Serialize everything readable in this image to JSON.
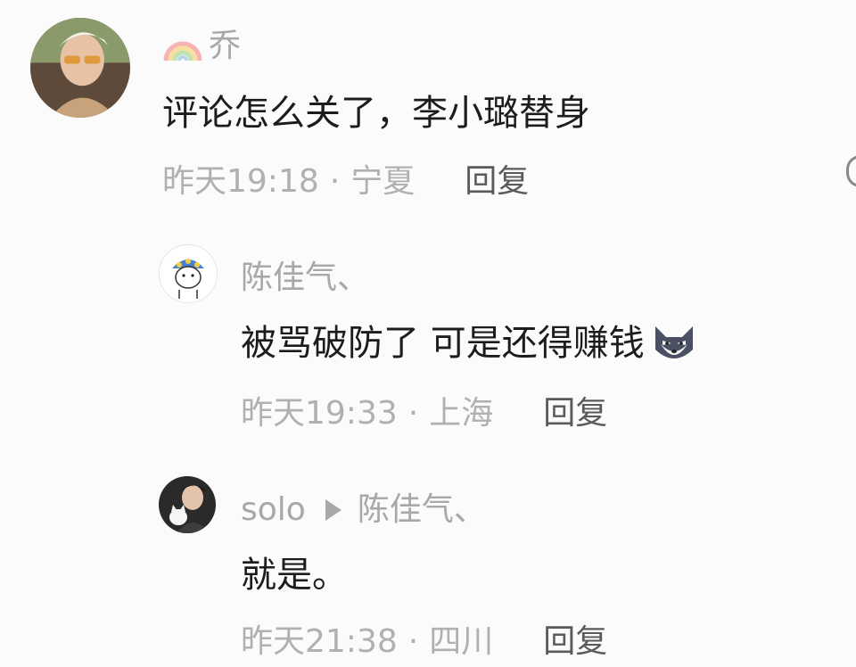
{
  "comments": [
    {
      "username": "乔",
      "content": "评论怎么关了，李小璐替身",
      "time": "昨天19:18",
      "separator": "·",
      "location": "宁夏",
      "reply_label": "回复"
    },
    {
      "username": "陈佳气、",
      "content": "被骂破防了 可是还得赚钱",
      "time": "昨天19:33",
      "separator": "·",
      "location": "上海",
      "reply_label": "回复"
    },
    {
      "username": "solo",
      "reply_to": "陈佳气、",
      "content": "就是。",
      "time": "昨天21:38",
      "separator": "·",
      "location": "四川",
      "reply_label": "回复"
    }
  ],
  "icons": {
    "username_badge": "rainbow-icon",
    "reply_arrow": "triangle-icon",
    "content_emoji": "wolf-emoji"
  }
}
